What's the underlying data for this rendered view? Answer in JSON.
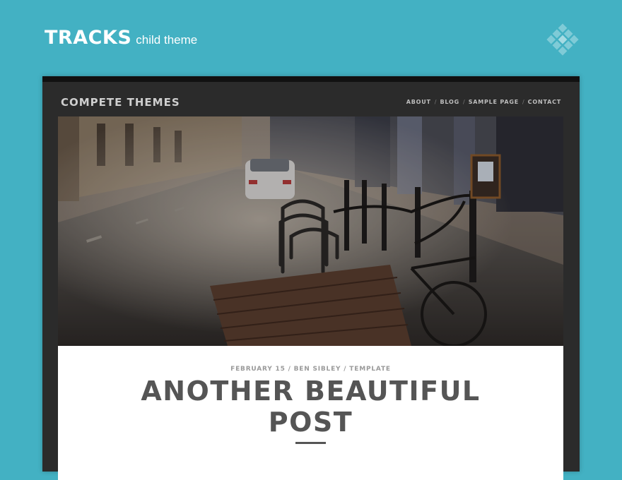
{
  "banner": {
    "title": "TRACKS",
    "subtitle": "child theme",
    "logo_icon": "diamond-grid-logo-icon"
  },
  "site": {
    "title": "COMPETE THEMES",
    "nav": [
      {
        "label": "ABOUT"
      },
      {
        "label": "BLOG"
      },
      {
        "label": "SAMPLE PAGE"
      },
      {
        "label": "CONTACT"
      }
    ],
    "nav_separator": "/"
  },
  "hero": {
    "icon": "street-bicycle-photo"
  },
  "post": {
    "meta": "FEBRUARY 15 / BEN SIBLEY / TEMPLATE",
    "title": "ANOTHER BEAUTIFUL POST"
  },
  "colors": {
    "background": "#43b1c3",
    "site_background": "#2b2b2b",
    "card": "#ffffff",
    "title_text": "#555555"
  }
}
